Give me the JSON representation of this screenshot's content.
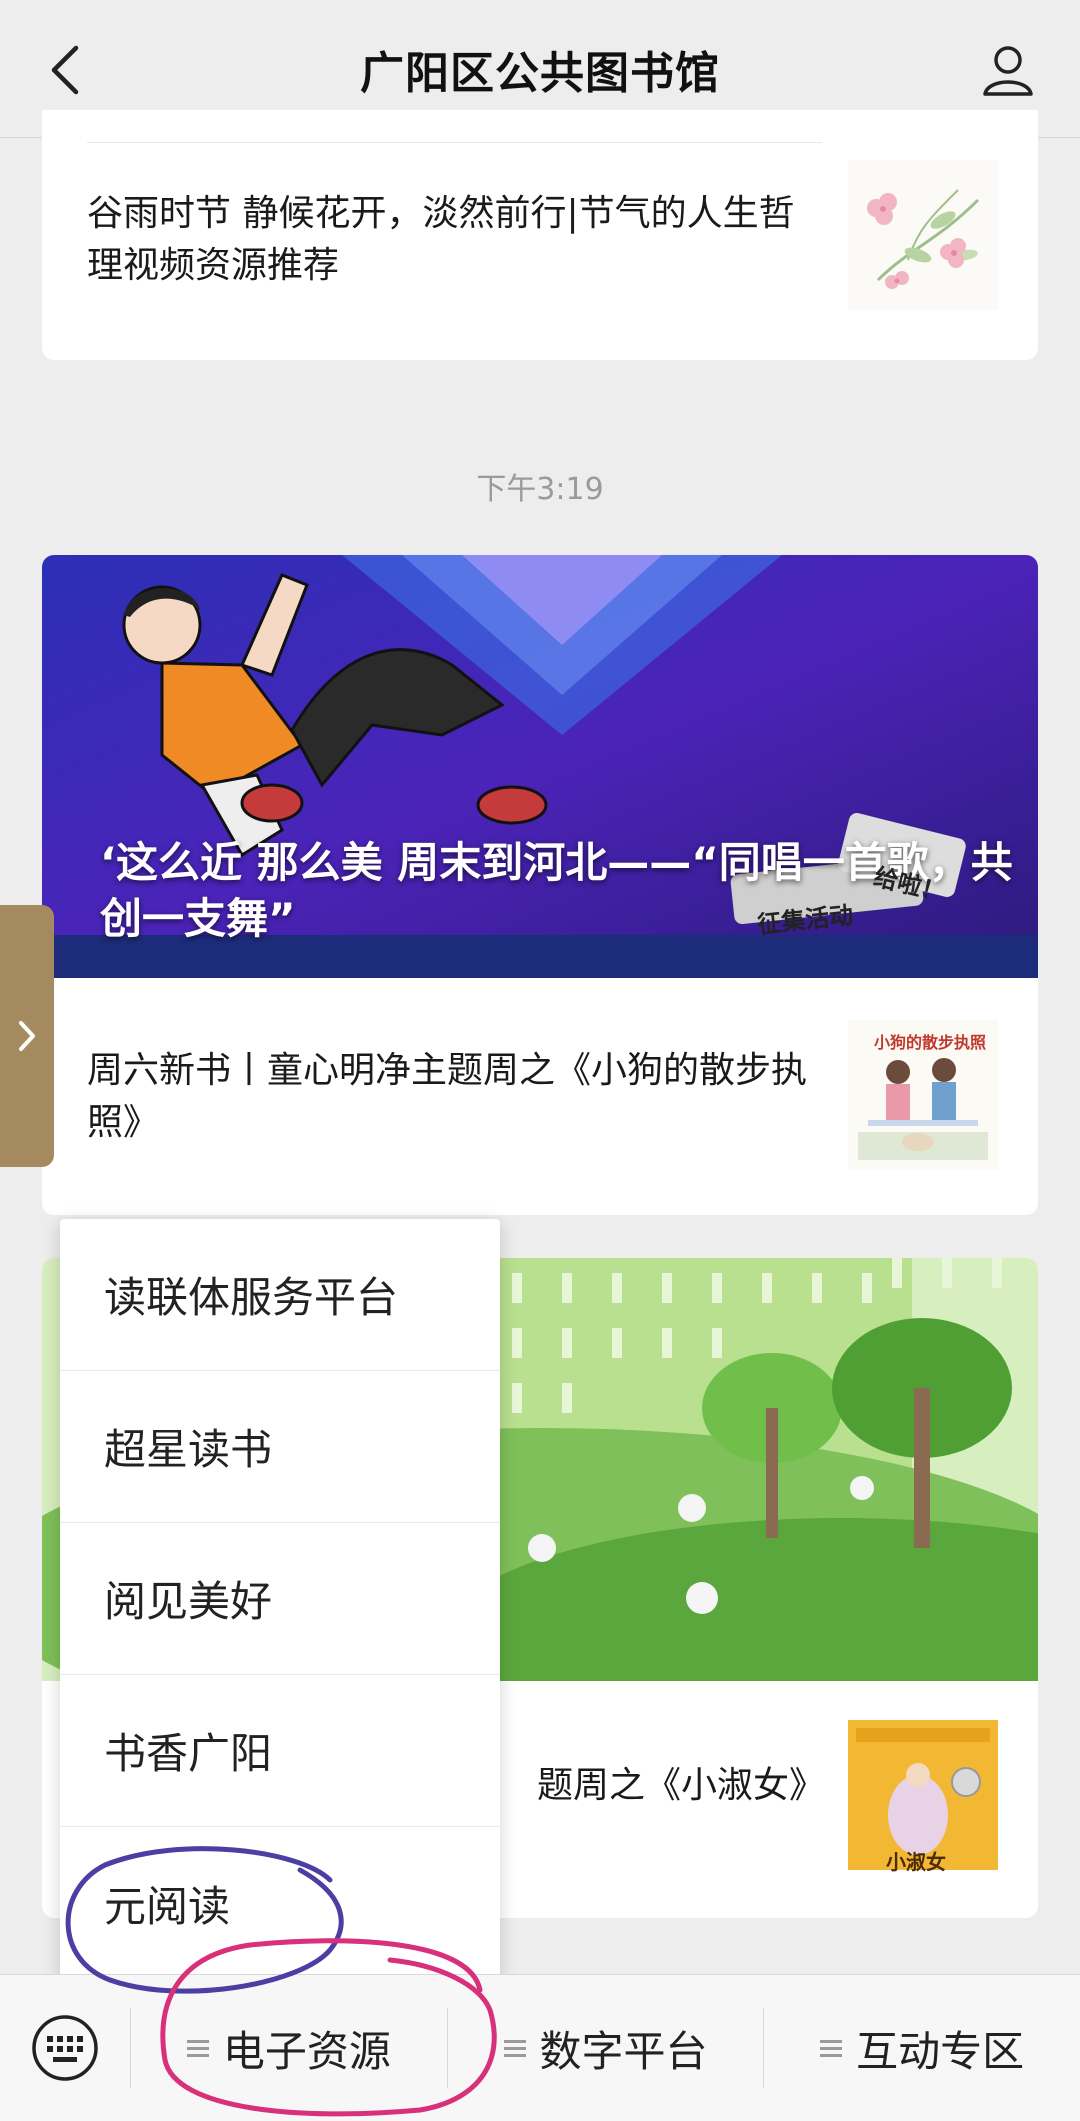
{
  "header": {
    "title": "广阳区公共图书馆",
    "back_icon": "chevron-left-icon",
    "user_icon": "user-icon"
  },
  "feed": {
    "prev_item": {
      "title": "谷雨时节 静候花开，淡然前行|节气的人生哲理视频资源推荐",
      "thumb_icon": "flower-illustration"
    },
    "timestamp": "下午3:19",
    "news1": {
      "cover_title": "‘这么近 那么美 周末到河北——“同唱一首歌，共创一支舞”",
      "cover_badge_1": "征集活动",
      "cover_badge_2": "给啦！",
      "item_title": "周六新书丨童心明净主题周之《小狗的散步执照》",
      "thumb_label": "小狗的散步执照"
    },
    "news2": {
      "item_title_visible": "题周之《小淑女》",
      "thumb_label": "小淑女"
    }
  },
  "popup_menu": {
    "items": [
      {
        "label": "读联体服务平台"
      },
      {
        "label": "超星读书"
      },
      {
        "label": "阅见美好"
      },
      {
        "label": "书香广阳"
      },
      {
        "label": "元阅读"
      }
    ]
  },
  "bottom_bar": {
    "keyboard_icon": "keyboard-icon",
    "tabs": [
      {
        "label": "电子资源"
      },
      {
        "label": "数字平台"
      },
      {
        "label": "互动专区"
      }
    ]
  },
  "colors": {
    "background": "#ededed",
    "card": "#ffffff",
    "annotation_blue": "#4b3fa3",
    "annotation_pink": "#d8307a"
  }
}
